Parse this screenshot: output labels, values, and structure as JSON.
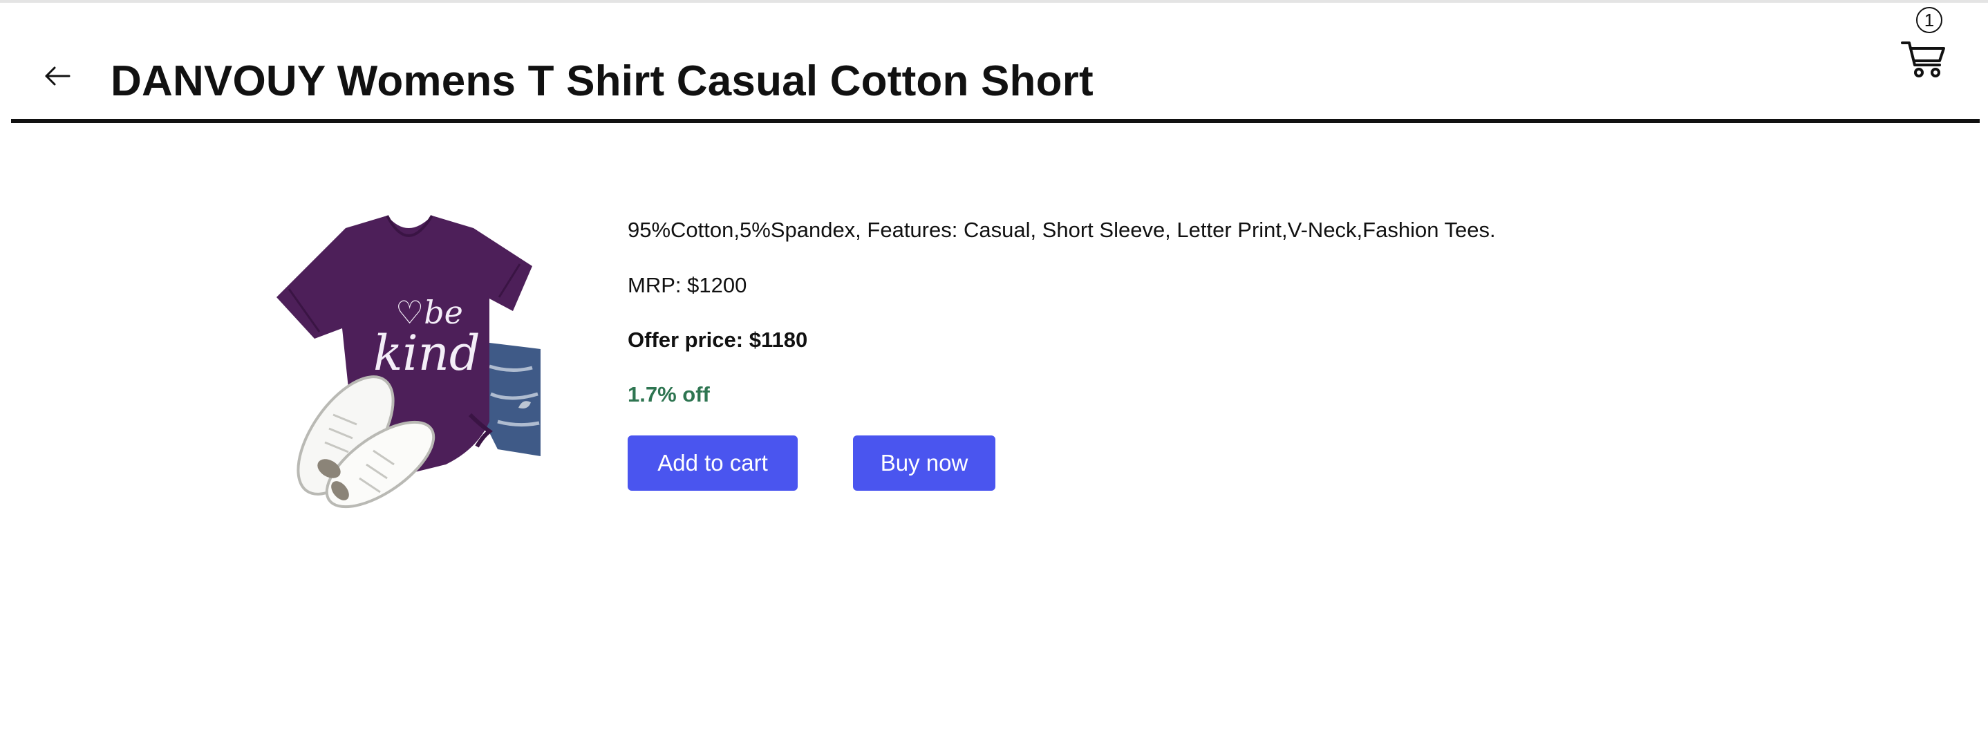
{
  "header": {
    "title": "DANVOUY Womens T Shirt Casual Cotton Short",
    "back_icon": "arrow-left-icon",
    "cart_icon": "shopping-cart-icon",
    "cart_count": "1"
  },
  "product": {
    "image_print_text": "be kind",
    "description": "95%Cotton,5%Spandex, Features: Casual, Short Sleeve, Letter Print,V-Neck,Fashion Tees.",
    "mrp": "MRP: $1200",
    "offer_price": "Offer price: $1180",
    "discount": "1.7% off",
    "discount_color": "#2e7551"
  },
  "actions": {
    "add_to_cart_label": "Add to cart",
    "buy_now_label": "Buy now",
    "button_color": "#4a55ef"
  }
}
